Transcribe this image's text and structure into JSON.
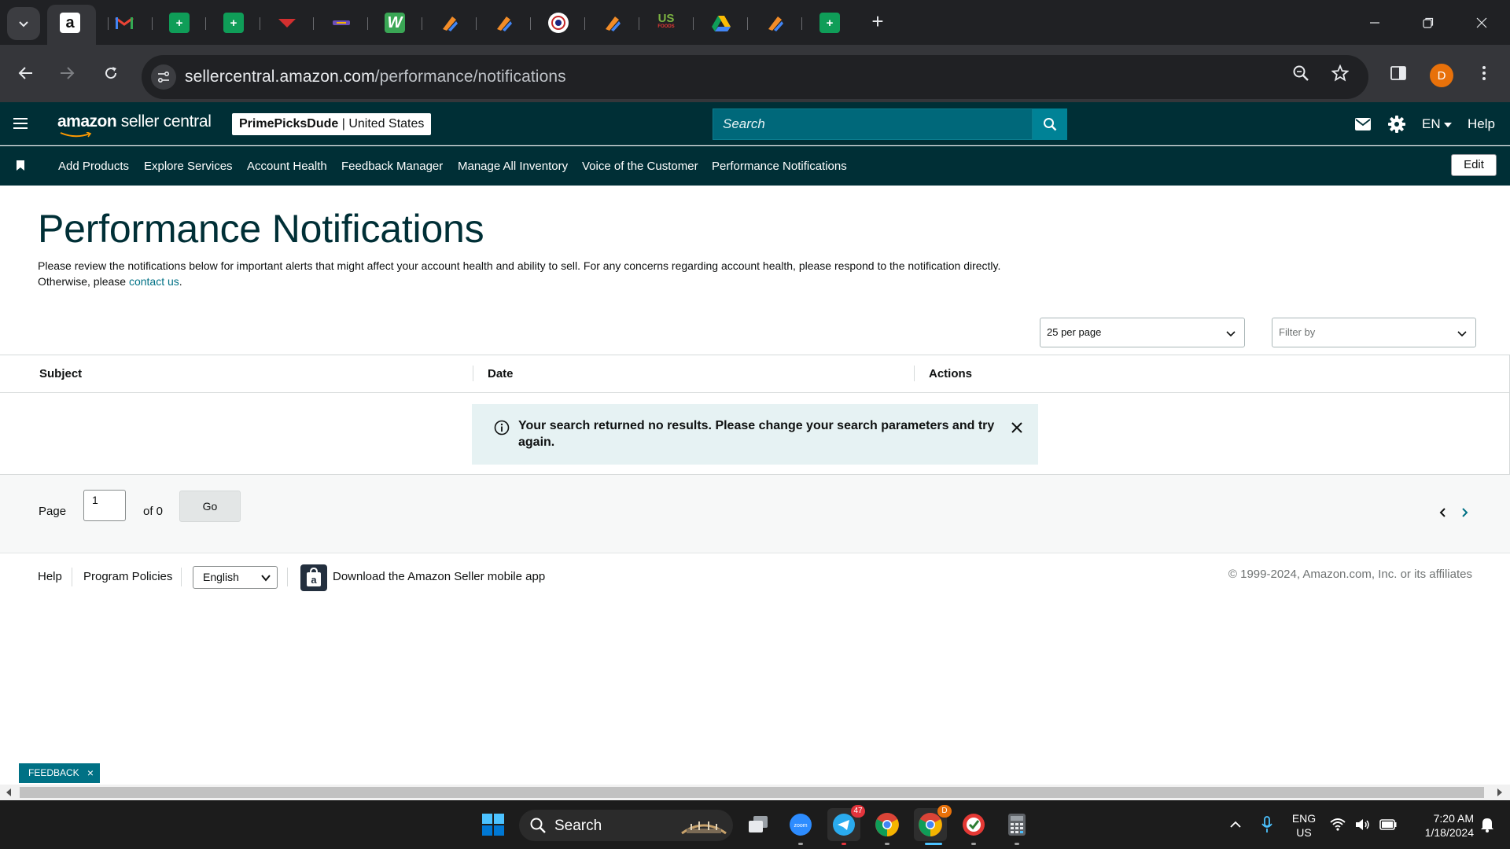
{
  "browser": {
    "url_host": "sellercentral.amazon.com",
    "url_path": "/performance/notifications",
    "profile_initial": "D",
    "tab_icons": [
      "amazon-icon",
      "gmail-icon",
      "sheets-icon",
      "sheets-icon",
      "red-brand-icon",
      "purple-brand-icon",
      "green-w-icon",
      "orange-pen-icon",
      "orange-pen-icon",
      "circle-logo-icon",
      "orange-pen-icon",
      "us-foods-icon",
      "google-drive-icon",
      "orange-pen-icon",
      "sheets-icon"
    ],
    "us_foods_label": "US",
    "us_foods_sub": "FOODS"
  },
  "header": {
    "logo_brand": "amazon",
    "logo_product": " seller central",
    "account_name": "PrimePicksDude",
    "account_region": " | United States",
    "search_placeholder": "Search",
    "lang": "EN",
    "help": "Help"
  },
  "nav": {
    "items": [
      "Add Products",
      "Explore Services",
      "Account Health",
      "Feedback Manager",
      "Manage All Inventory",
      "Voice of the Customer",
      "Performance Notifications"
    ],
    "edit": "Edit"
  },
  "page": {
    "title": "Performance Notifications",
    "desc_before": "Please review the notifications below for important alerts that might affect your account health and ability to sell. For any concerns regarding account health, please respond to the notification directly. Otherwise, please ",
    "desc_link": "contact us",
    "desc_after": ".",
    "per_page": "25 per page",
    "filter_placeholder": "Filter by"
  },
  "table": {
    "columns": [
      "Subject",
      "Date",
      "Actions"
    ],
    "alert_message": "Your search returned no results. Please change your search parameters and try again."
  },
  "pager": {
    "page_label": "Page",
    "page_value": "1",
    "of_label": "of 0",
    "go": "Go"
  },
  "footer": {
    "help": "Help",
    "policies": "Program Policies",
    "language": "English",
    "app_text": "Download the Amazon Seller mobile app",
    "copyright": "© 1999-2024, Amazon.com, Inc. or its affiliates"
  },
  "feedback": {
    "label": "FEEDBACK",
    "close": "×"
  },
  "taskbar": {
    "search": "Search",
    "telegram_badge": "47",
    "chrome_badge": "D",
    "lang_top": "ENG",
    "lang_bottom": "US",
    "time": "7:20 AM",
    "date": "1/18/2024"
  },
  "colors": {
    "sc_header": "#002f36",
    "sc_search": "#00687a",
    "link": "#007185",
    "alert_bg": "#e6f2f3"
  }
}
